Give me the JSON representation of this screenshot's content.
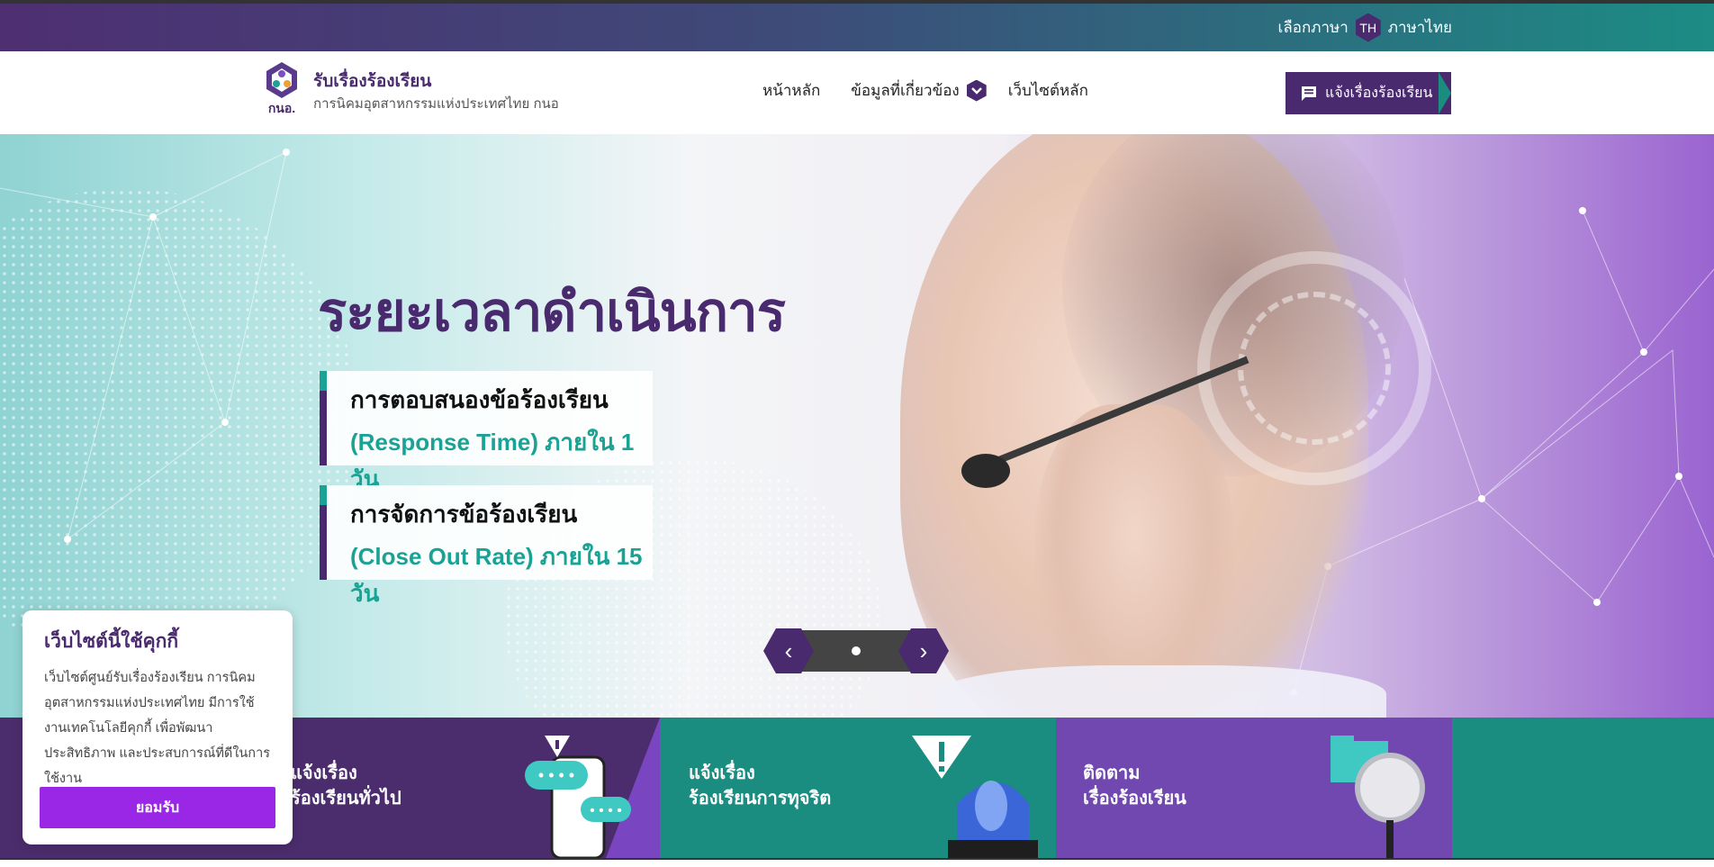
{
  "lang_bar": {
    "label": "เลือกภาษา",
    "code": "TH",
    "language": "ภาษาไทย"
  },
  "brand": {
    "title": "รับเรื่องร้องเรียน",
    "subtitle": "การนิคมอุตสาหกรรมแห่งประเทศไทย กนอ",
    "logo_text": "กนอ."
  },
  "nav": {
    "home": "หน้าหลัก",
    "related_info": "ข้อมูลที่เกี่ยวข้อง",
    "main_site": "เว็บไซต์หลัก"
  },
  "report_button": {
    "label": "แจ้งเรื่องร้องเรียน",
    "icon": "chat-icon"
  },
  "hero": {
    "title": "ระยะเวลาดำเนินการ",
    "card1": {
      "line1": "การตอบสนองข้อร้องเรียน",
      "line2": "(Response Time) ภายใน 1 วัน"
    },
    "card2": {
      "line1": "การจัดการข้อร้องเรียน",
      "line2": "(Close Out Rate) ภายใน 15 วัน"
    }
  },
  "slider": {
    "prev_icon": "chevron-left-icon",
    "next_icon": "chevron-right-icon",
    "prev": "‹",
    "next": "›",
    "active_index": 1,
    "total": 1
  },
  "tiles": {
    "general": {
      "line1": "แจ้งเรื่อง",
      "line2": "ร้องเรียนทั่วไป"
    },
    "corruption": {
      "line1": "แจ้งเรื่อง",
      "line2": "ร้องเรียนการทุจริต"
    },
    "track": {
      "line1": "ติดตาม",
      "line2": "เรื่องร้องเรียน"
    }
  },
  "cookie": {
    "title": "เว็บไซต์นี้ใช้คุกกี้",
    "text": "เว็บไซต์ศูนย์รับเรื่องร้องเรียน การนิคมอุตสาหกรรมแห่งประเทศไทย มีการใช้งานเทคโนโลยีคุกกี้ เพื่อพัฒนาประสิทธิภาพ และประสบการณ์ที่ดีในการใช้งาน",
    "accept": "ยอมรับ"
  },
  "colors": {
    "brand_purple": "#4a2a6e",
    "teal": "#1a8c80",
    "accent_purple": "#9b27e6",
    "tile_purple": "#7048b0"
  }
}
